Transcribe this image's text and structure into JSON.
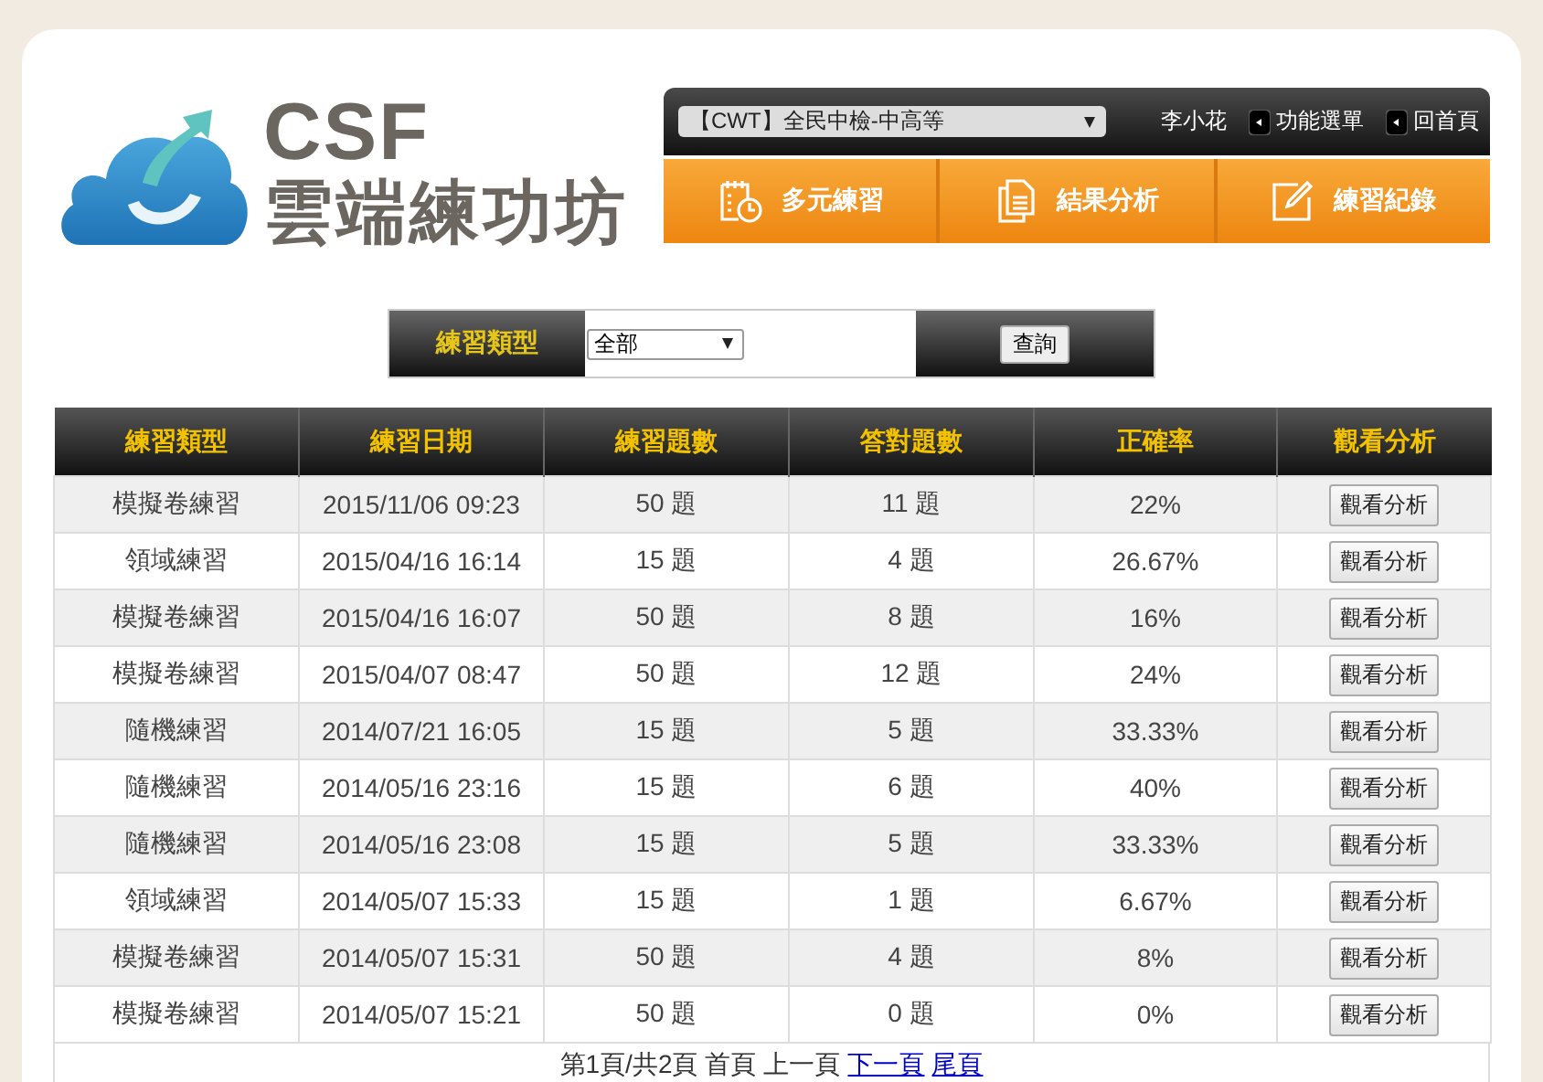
{
  "logo": {
    "title": "CSF",
    "subtitle": "雲端練功坊"
  },
  "header": {
    "exam_select": {
      "value": "【CWT】全民中檢-中高等"
    },
    "user_name": "李小花",
    "links": [
      "功能選單",
      "回首頁"
    ]
  },
  "nav": [
    {
      "label": "多元練習",
      "kind": "calendar"
    },
    {
      "label": "結果分析",
      "kind": "document"
    },
    {
      "label": "練習紀錄",
      "kind": "edit"
    }
  ],
  "filter": {
    "label": "練習類型",
    "select": {
      "value": "全部"
    },
    "button": "查詢"
  },
  "table": {
    "columns": [
      "練習類型",
      "練習日期",
      "練習題數",
      "答對題數",
      "正確率",
      "觀看分析"
    ],
    "rows": [
      [
        "模擬卷練習",
        "2015/11/06 09:23",
        "50 題",
        "11 題",
        "22%",
        "觀看分析"
      ],
      [
        "領域練習",
        "2015/04/16 16:14",
        "15 題",
        "4 題",
        "26.67%",
        "觀看分析"
      ],
      [
        "模擬卷練習",
        "2015/04/16 16:07",
        "50 題",
        "8 題",
        "16%",
        "觀看分析"
      ],
      [
        "模擬卷練習",
        "2015/04/07 08:47",
        "50 題",
        "12 題",
        "24%",
        "觀看分析"
      ],
      [
        "隨機練習",
        "2014/07/21 16:05",
        "15 題",
        "5 題",
        "33.33%",
        "觀看分析"
      ],
      [
        "隨機練習",
        "2014/05/16 23:16",
        "15 題",
        "6 題",
        "40%",
        "觀看分析"
      ],
      [
        "隨機練習",
        "2014/05/16 23:08",
        "15 題",
        "5 題",
        "33.33%",
        "觀看分析"
      ],
      [
        "領域練習",
        "2014/05/07 15:33",
        "15 題",
        "1 題",
        "6.67%",
        "觀看分析"
      ],
      [
        "模擬卷練習",
        "2014/05/07 15:31",
        "50 題",
        "4 題",
        "8%",
        "觀看分析"
      ],
      [
        "模擬卷練習",
        "2014/05/07 15:21",
        "50 題",
        "0 題",
        "0%",
        "觀看分析"
      ]
    ]
  },
  "pagination": [
    {
      "text": "第1頁/共2頁",
      "kind": "text"
    },
    {
      "text": "首頁",
      "kind": "text"
    },
    {
      "text": "上一頁",
      "kind": "text"
    },
    {
      "text": "下一頁",
      "kind": "link"
    },
    {
      "text": "尾頁",
      "kind": "link"
    }
  ]
}
